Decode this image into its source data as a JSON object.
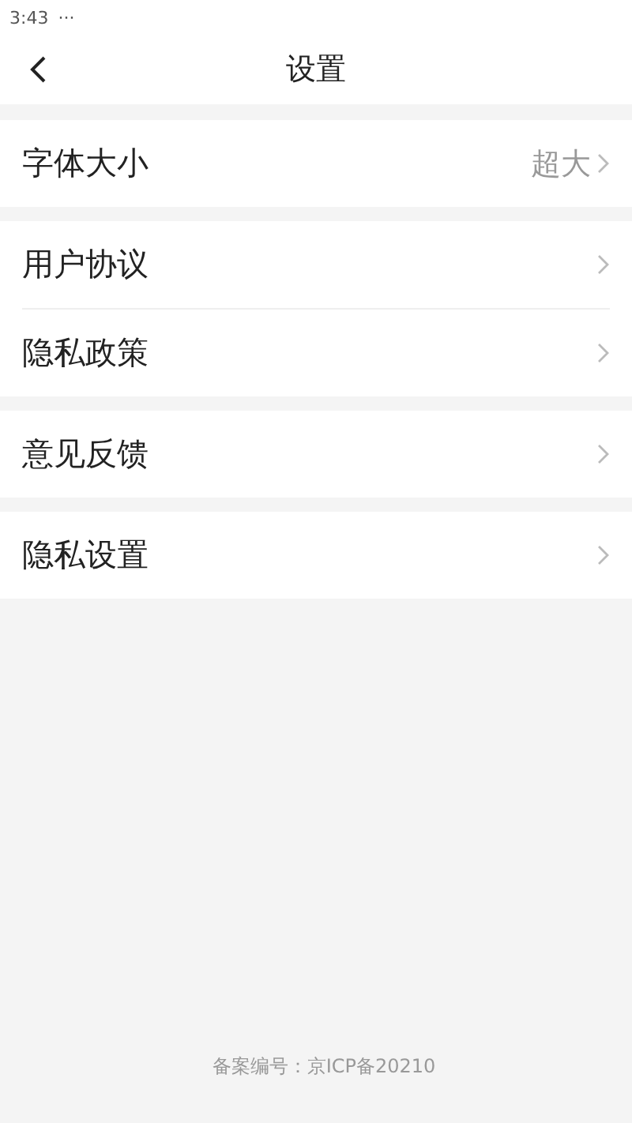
{
  "status_bar": {
    "time": "3:43",
    "more": "···"
  },
  "header": {
    "title": "设置"
  },
  "groups": [
    {
      "items": [
        {
          "label": "字体大小",
          "value": "超大"
        }
      ]
    },
    {
      "items": [
        {
          "label": "用户协议"
        },
        {
          "label": "隐私政策"
        }
      ]
    },
    {
      "items": [
        {
          "label": "意见反馈"
        }
      ]
    },
    {
      "items": [
        {
          "label": "隐私设置"
        }
      ]
    }
  ],
  "footer": {
    "text": "备案编号：京ICP备20210"
  }
}
